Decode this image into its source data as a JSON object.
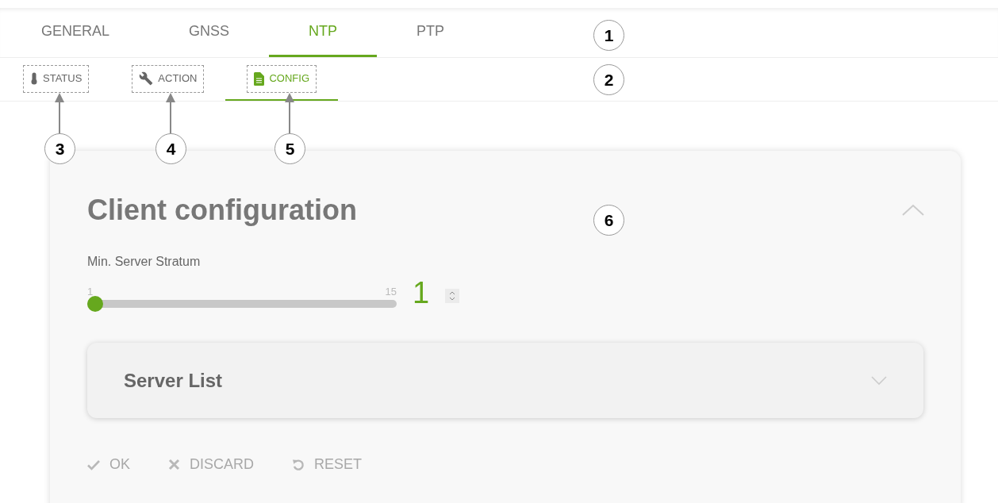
{
  "tabs": [
    {
      "label": "GENERAL",
      "selected": false
    },
    {
      "label": "GNSS",
      "selected": false
    },
    {
      "label": "NTP",
      "selected": true
    },
    {
      "label": "PTP",
      "selected": false
    }
  ],
  "subtabs": [
    {
      "label": "STATUS",
      "kind": "status",
      "selected": false
    },
    {
      "label": "ACTION",
      "kind": "action",
      "selected": false
    },
    {
      "label": "CONFIG",
      "kind": "config",
      "selected": true
    }
  ],
  "card": {
    "title": "Client configuration",
    "expanded": true,
    "slider": {
      "label": "Min. Server Stratum",
      "min_label": "1",
      "max_label": "15",
      "level": 0,
      "value": "1"
    },
    "sections": [
      {
        "title": "Server List",
        "expanded": false
      }
    ],
    "buttons": [
      {
        "label": "OK",
        "kind": "ok",
        "disabled": true
      },
      {
        "label": "DISCARD",
        "kind": "discard",
        "disabled": true
      },
      {
        "label": "RESET",
        "kind": "reset",
        "disabled": true
      }
    ]
  },
  "callouts": [
    "1",
    "2",
    "3",
    "4",
    "5",
    "6"
  ]
}
